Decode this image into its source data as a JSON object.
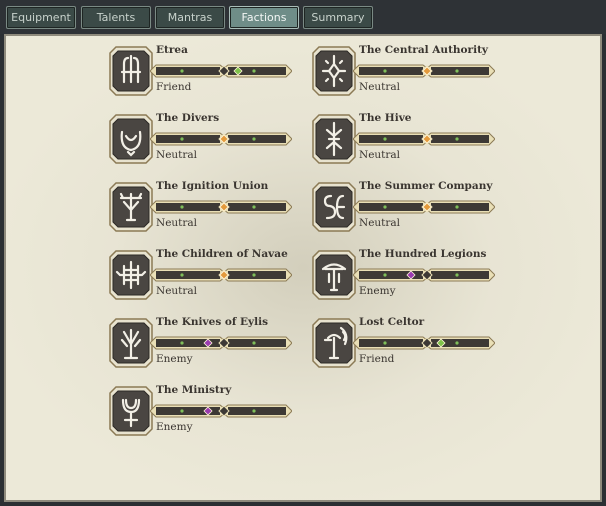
{
  "tabs": [
    {
      "label": "Equipment",
      "active": false
    },
    {
      "label": "Talents",
      "active": false
    },
    {
      "label": "Mantras",
      "active": false
    },
    {
      "label": "Factions",
      "active": true
    },
    {
      "label": "Summary",
      "active": false
    }
  ],
  "factions": [
    {
      "name": "Etrea",
      "standing": "Friend",
      "icon": "etrea-emblem-icon",
      "gem": "friend-green"
    },
    {
      "name": "The Central Authority",
      "standing": "Neutral",
      "icon": "central-authority-emblem-icon",
      "gem": "neutral-center"
    },
    {
      "name": "The Divers",
      "standing": "Neutral",
      "icon": "divers-emblem-icon",
      "gem": "neutral-center"
    },
    {
      "name": "The Hive",
      "standing": "Neutral",
      "icon": "hive-emblem-icon",
      "gem": "neutral-center"
    },
    {
      "name": "The Ignition Union",
      "standing": "Neutral",
      "icon": "ignition-union-emblem-icon",
      "gem": "neutral-center"
    },
    {
      "name": "The Summer Company",
      "standing": "Neutral",
      "icon": "summer-company-emblem-icon",
      "gem": "neutral-center"
    },
    {
      "name": "The Children of Navae",
      "standing": "Neutral",
      "icon": "children-of-navae-emblem-icon",
      "gem": "neutral-center"
    },
    {
      "name": "The Hundred Legions",
      "standing": "Enemy",
      "icon": "hundred-legions-emblem-icon",
      "gem": "enemy-purple"
    },
    {
      "name": "The Knives of Eylis",
      "standing": "Enemy",
      "icon": "knives-of-eylis-emblem-icon",
      "gem": "enemy-purple"
    },
    {
      "name": "Lost Celtor",
      "standing": "Friend",
      "icon": "lost-celtor-emblem-icon",
      "gem": "friend-green"
    },
    {
      "name": "The Ministry",
      "standing": "Enemy",
      "icon": "ministry-emblem-icon",
      "gem": "enemy-purple"
    }
  ],
  "colors": {
    "neutral": "#e39a3c",
    "friend": "#7fc24a",
    "enemy": "#9a3bb0",
    "bar": "#3d3935",
    "frame": "#8e8a7c"
  }
}
